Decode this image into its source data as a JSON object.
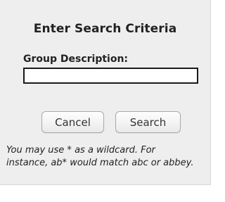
{
  "dialog": {
    "title": "Enter Search Criteria",
    "field_label": "Group Description:",
    "input_value": "",
    "cancel_label": "Cancel",
    "search_label": "Search",
    "help_text": "You may use * as a wildcard. For instance, ab* would match abc or abbey."
  },
  "colors": {
    "background": "#eeeeee",
    "input_border": "#1a1a1a",
    "button_border": "#a9a9a9"
  }
}
